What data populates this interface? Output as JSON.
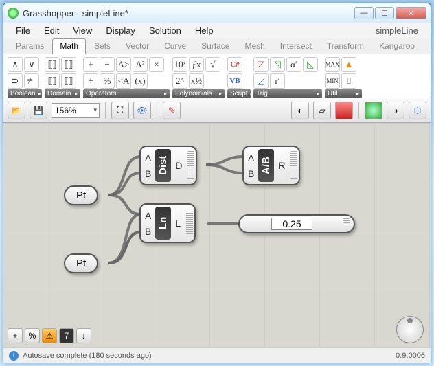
{
  "window": {
    "title": "Grasshopper - simpleLine*"
  },
  "menus": [
    "File",
    "Edit",
    "View",
    "Display",
    "Solution",
    "Help"
  ],
  "doc_name": "simpleLine",
  "tabs": [
    "Params",
    "Math",
    "Sets",
    "Vector",
    "Curve",
    "Surface",
    "Mesh",
    "Intersect",
    "Transform",
    "Kangaroo"
  ],
  "active_tab": 1,
  "ribbon": {
    "groups": [
      {
        "label": "Boolean",
        "icons": [
          "∧",
          "∨",
          "⊃",
          "≢"
        ]
      },
      {
        "label": "Domain",
        "icons": [
          "⟦⟧",
          "⟦⟧",
          "⟦⟧",
          "⟦⟧"
        ]
      },
      {
        "label": "Operators",
        "icons": [
          "+",
          "−",
          "×",
          "÷",
          "A>",
          "<A",
          "A²",
          "%",
          "(x)"
        ]
      },
      {
        "label": "Polynomials",
        "icons": [
          "10ˣ",
          "√",
          "ƒx",
          "2ᴬ",
          "x½"
        ]
      },
      {
        "label": "Script",
        "icons": [
          "C#",
          "VB"
        ]
      },
      {
        "label": "Trig",
        "icons": [
          "◸",
          "◹",
          "◺",
          "◿",
          "α′",
          "r′"
        ]
      },
      {
        "label": "Util",
        "icons": [
          "MAX",
          "MIN",
          "▲",
          "⌷"
        ]
      }
    ]
  },
  "toolbar": {
    "zoom": "156%"
  },
  "components": {
    "pt1": {
      "label": "Pt"
    },
    "pt2": {
      "label": "Pt"
    },
    "dist": {
      "core": "Dist",
      "in": [
        "A",
        "B"
      ],
      "out": [
        "D"
      ]
    },
    "div": {
      "core": "A/B",
      "in": [
        "A",
        "B"
      ],
      "out": [
        "R"
      ]
    },
    "ln": {
      "core": "Ln",
      "in": [
        "A",
        "B"
      ],
      "out": [
        "L"
      ]
    },
    "panel": {
      "value": "0.25"
    }
  },
  "status": {
    "msg": "Autosave complete (180 seconds ago)",
    "version": "0.9.0006"
  }
}
